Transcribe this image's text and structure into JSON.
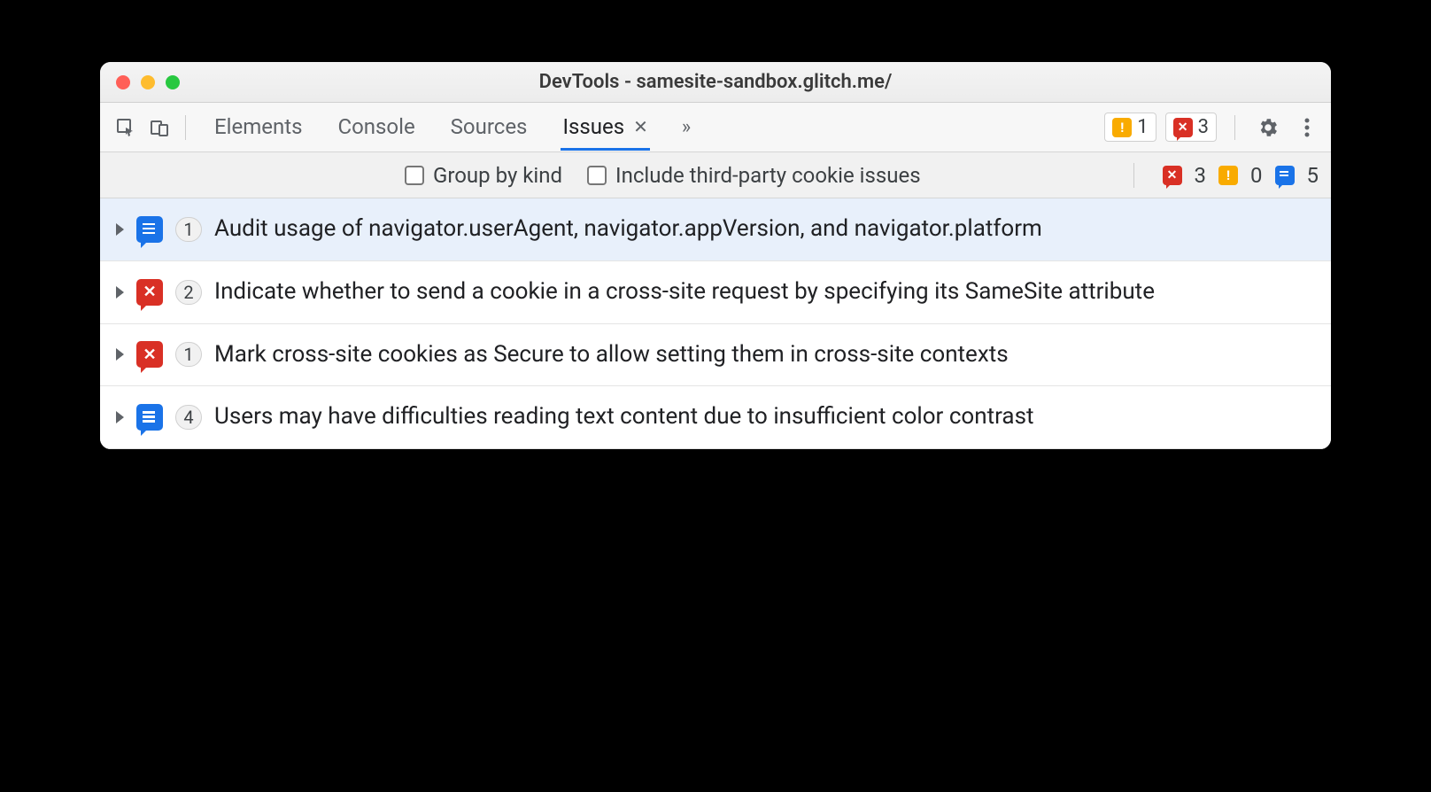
{
  "window": {
    "title": "DevTools - samesite-sandbox.glitch.me/"
  },
  "tabs": {
    "elements": "Elements",
    "console": "Console",
    "sources": "Sources",
    "issues": "Issues"
  },
  "toolbar_counts": {
    "warnings": "1",
    "errors": "3"
  },
  "filter": {
    "group_by_kind": "Group by kind",
    "include_third_party": "Include third-party cookie issues",
    "counts": {
      "errors": "3",
      "warnings": "0",
      "info": "5"
    }
  },
  "issues": [
    {
      "type": "chat",
      "count": "1",
      "title": "Audit usage of navigator.userAgent, navigator.appVersion, and navigator.platform",
      "selected": true
    },
    {
      "type": "err",
      "count": "2",
      "title": "Indicate whether to send a cookie in a cross-site request by specifying its SameSite attribute",
      "selected": false
    },
    {
      "type": "err",
      "count": "1",
      "title": "Mark cross-site cookies as Secure to allow setting them in cross-site contexts",
      "selected": false
    },
    {
      "type": "chat",
      "count": "4",
      "title": "Users may have difficulties reading text content due to insufficient color contrast",
      "selected": false
    }
  ]
}
